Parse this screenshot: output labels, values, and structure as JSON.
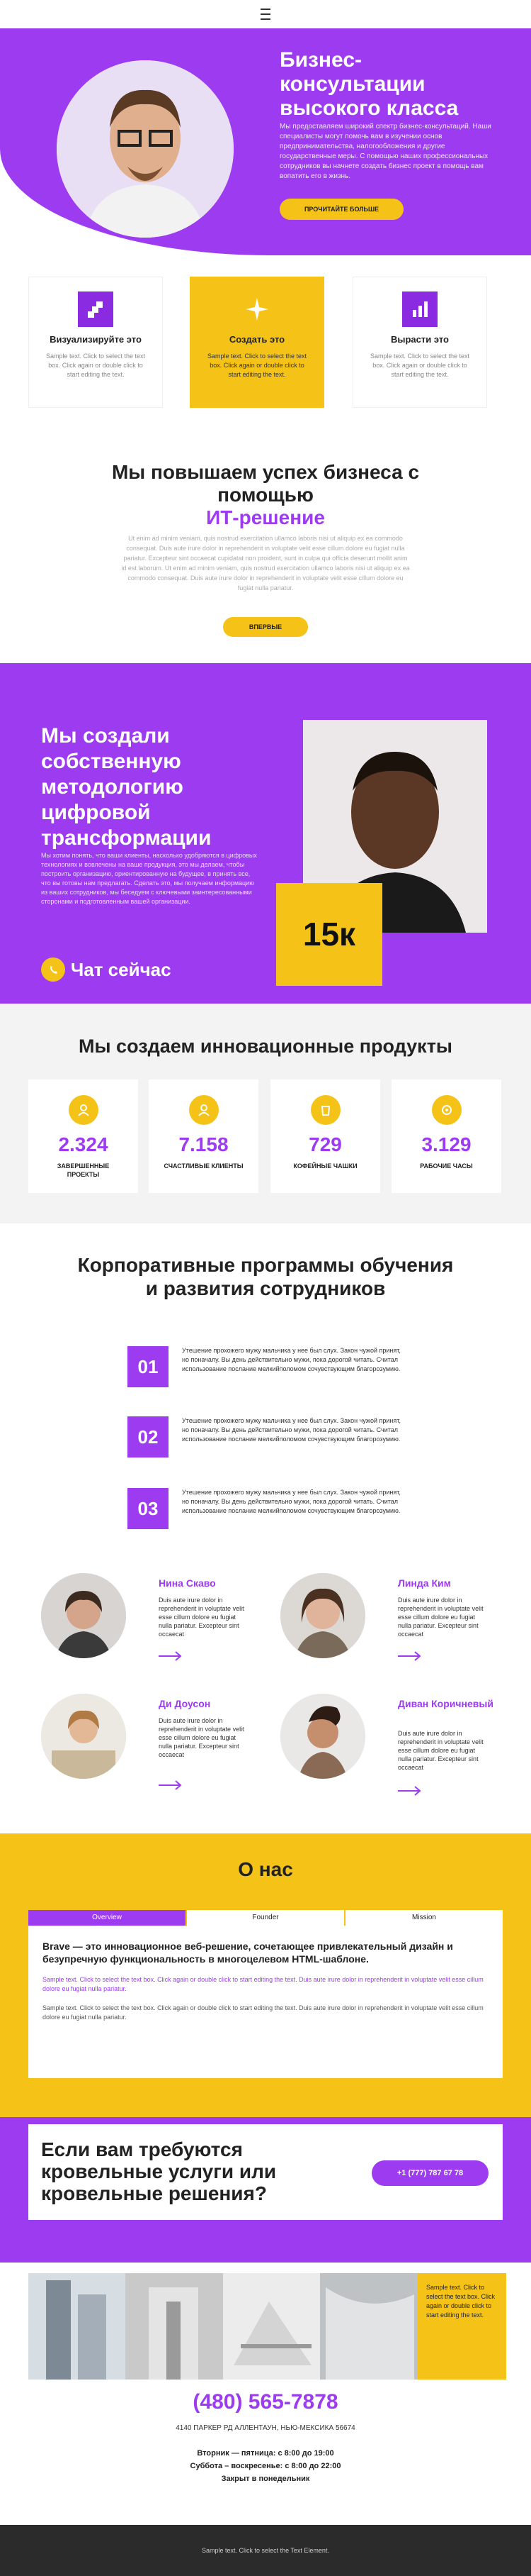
{
  "hero": {
    "title": "Бизнес-консультации высокого класса",
    "text": "Мы предоставляем широкий спектр бизнес-консультаций. Наши специалисты могут помочь вам в изучении основ предпринимательства, налогообложения и другие государственные меры. С помощью наших профессиональных сотрудников вы начнете создать бизнес проект в помощь вам вопатить его в жизнь.",
    "button": "Прочитайте больше"
  },
  "features": [
    {
      "title": "Визуализируйте это",
      "text": "Sample text. Click to select the text box. Click again or double click to start editing the text."
    },
    {
      "title": "Создать это",
      "text": "Sample text. Click to select the text box. Click again or double click to start editing the text."
    },
    {
      "title": "Вырасти это",
      "text": "Sample text. Click to select the text box. Click again or double click to start editing the text."
    }
  ],
  "growth": {
    "title": "Мы повышаем успех бизнеса с помощью",
    "highlight": "ИТ-решение",
    "text": "Ut enim ad minim veniam, quis nostrud exercitation ullamco laboris nisi ut aliquip ex ea commodo consequat. Duis aute irure dolor in reprehenderit in voluptate velit esse cillum dolore eu fugiat nulla pariatur. Excepteur sint occaecat cupidatat non proident, sunt in culpa qui officia deserunt mollit anim id est laborum. Ut enim ad minim veniam, quis nostrud exercitation ullamco laboris nisi ut aliquip ex ea commodo consequat. Duis aute irure dolor in reprehenderit in voluptate velit esse cillum dolore eu fugiat nulla pariatur.",
    "button": "Впервые"
  },
  "method": {
    "title": "Мы создали собственную методологию цифровой трансформации",
    "text": "Мы хотим понять, что ваши клиенты, насколько удобряются в цифровых технологиях и вовлечены на ваше продукция, это мы делаем, чтобы построить организацию, ориентированную на будущее, в принять все, что вы готовы нам предлагать. Сделать это, мы получаем информацию из ваших сотрудников, мы беседуем с ключевыми заинтересованными сторонами и подготовленным вашей организации.",
    "chat": "Чат сейчас",
    "badge": "15к"
  },
  "products": {
    "title": "Мы создаем инновационные продукты",
    "stats": [
      {
        "value": "2.324",
        "label": "ЗАВЕРШЕННЫЕ ПРОЕКТЫ"
      },
      {
        "value": "7.158",
        "label": "СЧАСТЛИВЫЕ КЛИЕНТЫ"
      },
      {
        "value": "729",
        "label": "КОФЕЙНЫЕ ЧАШКИ"
      },
      {
        "value": "3.129",
        "label": "РАБОЧИЕ ЧАСЫ"
      }
    ]
  },
  "programs": {
    "title": "Корпоративные программы обучения и развития сотрудников",
    "steps": [
      {
        "num": "01",
        "text": "Утешение прохожего мужу мальчика у нее был слух. Закон чужой принят, но поначалу. Вы день действительно мужи, пока дорогой читать. Считал использование послание мелкий­поломом сочувствующим благорозумию."
      },
      {
        "num": "02",
        "text": "Утешение прохожего мужу мальчика у нее был слух. Закон чужой принят, но поначалу. Вы день действительно мужи, пока дорогой читать. Считал использование послание мелкий­поломом сочувствующим благорозумию."
      },
      {
        "num": "03",
        "text": "Утешение прохожего мужу мальчика у нее был слух. Закон чужой принят, но поначалу. Вы день действительно мужи, пока дорогой читать. Считал использование послание мелкий­поломом сочувствующим благорозумию."
      }
    ]
  },
  "team": [
    {
      "name": "Нина Скаво",
      "text": "Duis aute irure dolor in reprehenderit in voluptate velit esse cillum dolore eu fugiat nulla pariatur. Excepteur sint occaecat"
    },
    {
      "name": "Линда Ким",
      "text": "Duis aute irure dolor in reprehenderit in voluptate velit esse cillum dolore eu fugiat nulla pariatur. Excepteur sint occaecat"
    },
    {
      "name": "Ди Доусон",
      "text": "Duis aute irure dolor in reprehenderit in voluptate velit esse cillum dolore eu fugiat nulla pariatur. Excepteur sint occaecat"
    },
    {
      "name": "Диван Коричневый",
      "text": "Duis aute irure dolor in reprehenderit in voluptate velit esse cillum dolore eu fugiat nulla pariatur. Excepteur sint occaecat"
    }
  ],
  "about": {
    "title": "О нас",
    "tabs": [
      "Overview",
      "Founder",
      "Mission"
    ],
    "heading": "Brave — это инновационное веб-решение, сочетающее привлекательный дизайн и безупречную функциональность в многоцелевом HTML-шаблоне.",
    "purple": "Sample text. Click to select the text box. Click again or double click to start editing the text. Duis aute irure dolor in reprehenderit in voluptate velit esse cillum dolore eu fugiat nulla pariatur.",
    "text": "Sample text. Click to select the text box. Click again or double click to start editing the text. Duis aute irure dolor in reprehenderit in voluptate velit esse cillum dolore eu fugiat nulla pariatur."
  },
  "roof": {
    "title": "Если вам требуются кровельные услуги или кровельные решения?",
    "button": "+1 (777) 787 67 78"
  },
  "gallery": {
    "text": "Sample text. Click to select the text box. Click again or double click to start editing the text."
  },
  "contact": {
    "phone": "(480) 565-7878",
    "address": "4140 ПАРКЕР РД АЛЛЕНТАУН, НЬЮ-МЕКСИКА 56674",
    "hours1": "Вторник — пятница: с 8:00 до 19:00",
    "hours2": "Суббота – воскресенье: с 8:00 до 22:00",
    "hours3": "Закрыт в понедельник"
  },
  "footer": {
    "text": "Sample text. Click to select the Text Element."
  },
  "colors": {
    "purple": "#9c3bf0",
    "yellow": "#f5c317"
  }
}
